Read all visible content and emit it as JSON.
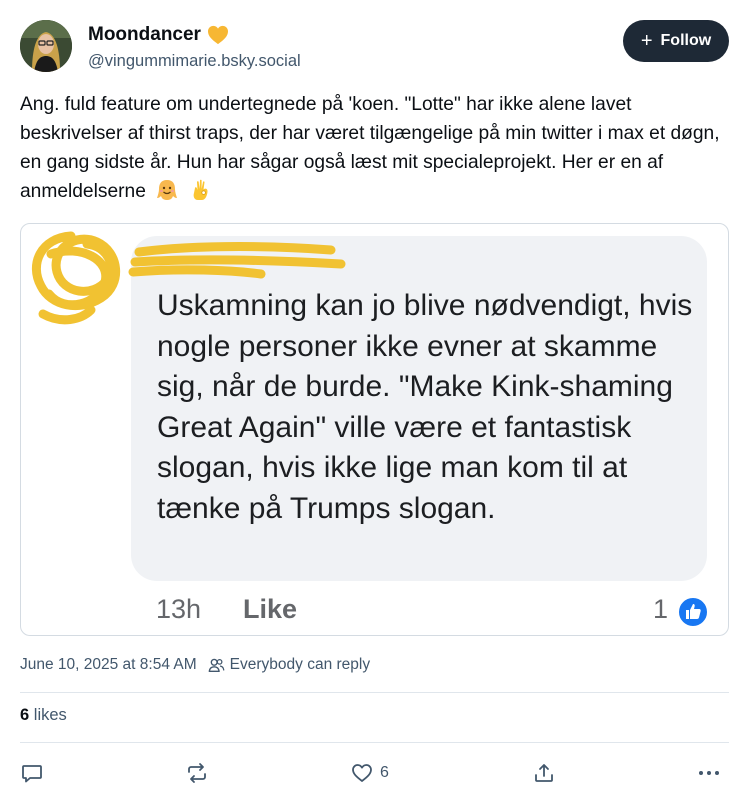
{
  "author": {
    "display_name": "Moondancer",
    "handle": "@vingummimarie.bsky.social",
    "avatar_icon": "avatar-photo",
    "badge_icon": "yellow-heart-icon"
  },
  "follow_button": {
    "label": "Follow",
    "icon": "plus-icon"
  },
  "post": {
    "text": "Ang. fuld feature om undertegnede på 'koen. \"Lotte\" har ikke alene lavet beskrivelser af thirst traps, der har været tilgængelige på min twitter i max et døgn, en gang sidste år. Hun har sågar også læst mit specialeprojekt. Her er en af anmeldelserne",
    "emojis": [
      "smiling-blob-emoji",
      "ok-hand-emoji"
    ]
  },
  "embedded_image": {
    "comment_text": "Uskamning kan jo blive nødvendigt, hvis nogle personer ikke evner at skamme sig, når de burde. \"Make Kink-shaming Great Again\" ville være et fantastisk slogan, hvis ikke lige man kom til at tænke på Trumps slogan.",
    "time_ago": "13h",
    "like_label": "Like",
    "like_count": "1",
    "redaction_color": "#f1c232",
    "like_badge_color": "#1877f2"
  },
  "meta": {
    "timestamp": "June 10, 2025 at 8:54 AM",
    "reply_setting": "Everybody can reply"
  },
  "stats": {
    "likes_count": "6",
    "likes_label": "likes"
  },
  "actions": {
    "reply_icon": "reply-icon",
    "repost_icon": "repost-icon",
    "like_icon": "heart-icon",
    "like_count": "6",
    "share_icon": "share-icon",
    "more_icon": "more-icon"
  },
  "colors": {
    "accent_dark": "#1e2936",
    "muted_text": "#42576c",
    "bubble_bg": "#f0f2f5"
  }
}
